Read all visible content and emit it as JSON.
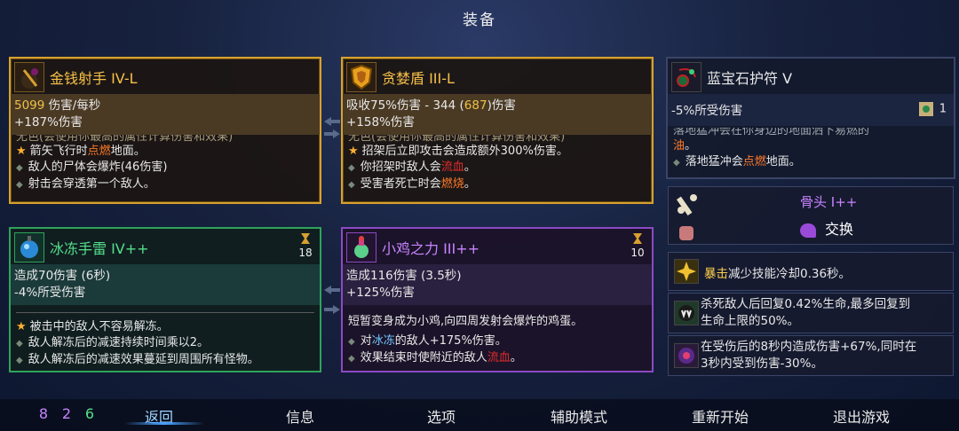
{
  "header": {
    "title": "装备"
  },
  "card1": {
    "name": "金钱射手 IV-L",
    "stat_num": "5099",
    "stat_text": " 伤害/每秒",
    "stat2": "+187%伤害",
    "truncated": "无色(会使用你最高的属性计算伤害和效果)",
    "line1_pre": "箭矢飞行时",
    "line1_hl": "点燃",
    "line1_post": "地面。",
    "line2": "敌人的尸体会爆炸(46伤害)",
    "line3": "射击会穿透第一个敌人。"
  },
  "card2": {
    "name": "贪婪盾 III-L",
    "stat_a": "吸收75%伤害 - 344 (",
    "stat_num": "687",
    "stat_b": ")伤害",
    "stat2": "+158%伤害",
    "truncated": "无色(会使用你最高的属性计算伤害和效果)",
    "line1": "招架后立即攻击会造成额外300%伤害。",
    "line2_pre": "你招架时敌人会",
    "line2_hl": "流血",
    "line2_post": "。",
    "line3_pre": "受害者死亡时会",
    "line3_hl": "燃烧",
    "line3_post": "。"
  },
  "card3": {
    "name": "蓝宝石护符 V",
    "stat": "-5%所受伤害",
    "count": "1",
    "truncated_a": "落地猛冲会在你身边的地面洒下易燃的",
    "truncated_b": "油",
    "truncated_c": "。",
    "line1_pre": "落地猛冲会",
    "line1_hl": "点燃",
    "line1_post": "地面。"
  },
  "card4": {
    "name": "冰冻手雷 IV++",
    "cooldown": "18",
    "stat1": "造成70伤害 (6秒)",
    "stat2": "-4%所受伤害",
    "line1": "被击中的敌人不容易解冻。",
    "line2": "敌人解冻后的减速持续时间乘以2。",
    "line3": "敌人解冻后的减速效果蔓延到周围所有怪物。"
  },
  "card5": {
    "name": "小鸡之力 III++",
    "cooldown": "10",
    "stat1": "造成116伤害 (3.5秒)",
    "stat2": "+125%伤害",
    "desc": "短暂变身成为小鸡,向四周发射会爆炸的鸡蛋。",
    "line1_pre": "对",
    "line1_hl": "冰冻",
    "line1_post": "的敌人+175%伤害。",
    "line2_pre": "效果结束时使附近的敌人",
    "line2_hl": "流血",
    "line2_post": "。"
  },
  "bone": {
    "name": "骨头 I++",
    "swap": "交换"
  },
  "mutations": [
    {
      "hl": "暴击",
      "text": "减少技能冷却0.36秒。"
    },
    {
      "line1": "杀死敌人后回复0.42%生命,最多回复到",
      "line2": "生命上限的50%。"
    },
    {
      "line1": "在受伤后的8秒内造成伤害+67%,同时在",
      "line2": "3秒内受到伤害-30%。"
    }
  ],
  "cells": {
    "a": "8",
    "b": "2",
    "c": "6"
  },
  "menu": {
    "back": "返回",
    "info": "信息",
    "options": "选项",
    "assist": "辅助模式",
    "restart": "重新开始",
    "quit": "退出游戏"
  },
  "colors": {
    "gold": "#d6a12e",
    "green": "#2fa35a",
    "purple": "#8c49c4",
    "fire": "#ff7a28",
    "blood": "#e02b2b"
  }
}
